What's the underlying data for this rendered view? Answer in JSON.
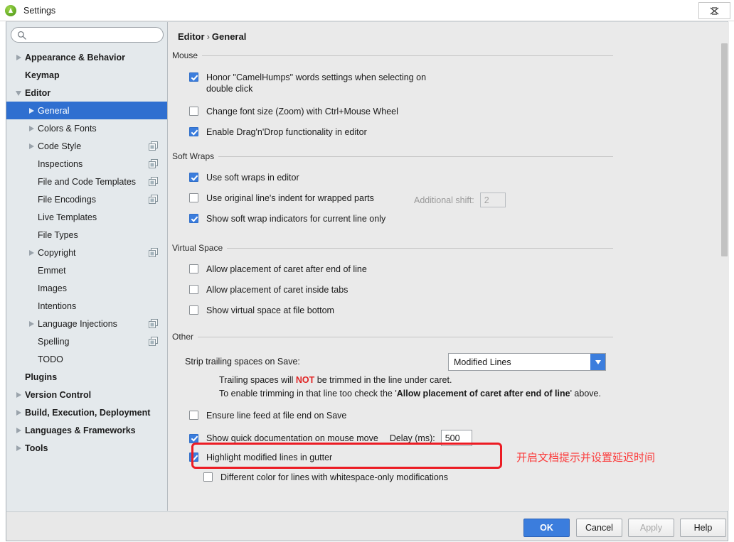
{
  "window": {
    "title": "Settings",
    "app_icon": "pycharm-icon",
    "close_label": "✕"
  },
  "sidebar": {
    "search": {
      "value": "",
      "placeholder": "",
      "icon": "search-icon"
    },
    "items": [
      {
        "label": "Appearance & Behavior",
        "indent": 0,
        "bold": true,
        "twisty": "right",
        "copy": false,
        "selected": false
      },
      {
        "label": "Keymap",
        "indent": 0,
        "bold": true,
        "twisty": "none",
        "copy": false,
        "selected": false
      },
      {
        "label": "Editor",
        "indent": 0,
        "bold": true,
        "twisty": "down",
        "copy": false,
        "selected": false
      },
      {
        "label": "General",
        "indent": 1,
        "bold": false,
        "twisty": "right",
        "copy": false,
        "selected": true
      },
      {
        "label": "Colors & Fonts",
        "indent": 1,
        "bold": false,
        "twisty": "right",
        "copy": false,
        "selected": false
      },
      {
        "label": "Code Style",
        "indent": 1,
        "bold": false,
        "twisty": "right",
        "copy": true,
        "selected": false
      },
      {
        "label": "Inspections",
        "indent": 1,
        "bold": false,
        "twisty": "none",
        "copy": true,
        "selected": false
      },
      {
        "label": "File and Code Templates",
        "indent": 1,
        "bold": false,
        "twisty": "none",
        "copy": true,
        "selected": false
      },
      {
        "label": "File Encodings",
        "indent": 1,
        "bold": false,
        "twisty": "none",
        "copy": true,
        "selected": false
      },
      {
        "label": "Live Templates",
        "indent": 1,
        "bold": false,
        "twisty": "none",
        "copy": false,
        "selected": false
      },
      {
        "label": "File Types",
        "indent": 1,
        "bold": false,
        "twisty": "none",
        "copy": false,
        "selected": false
      },
      {
        "label": "Copyright",
        "indent": 1,
        "bold": false,
        "twisty": "right",
        "copy": true,
        "selected": false
      },
      {
        "label": "Emmet",
        "indent": 1,
        "bold": false,
        "twisty": "none",
        "copy": false,
        "selected": false
      },
      {
        "label": "Images",
        "indent": 1,
        "bold": false,
        "twisty": "none",
        "copy": false,
        "selected": false
      },
      {
        "label": "Intentions",
        "indent": 1,
        "bold": false,
        "twisty": "none",
        "copy": false,
        "selected": false
      },
      {
        "label": "Language Injections",
        "indent": 1,
        "bold": false,
        "twisty": "right",
        "copy": true,
        "selected": false
      },
      {
        "label": "Spelling",
        "indent": 1,
        "bold": false,
        "twisty": "none",
        "copy": true,
        "selected": false
      },
      {
        "label": "TODO",
        "indent": 1,
        "bold": false,
        "twisty": "none",
        "copy": false,
        "selected": false
      },
      {
        "label": "Plugins",
        "indent": 0,
        "bold": true,
        "twisty": "none",
        "copy": false,
        "selected": false
      },
      {
        "label": "Version Control",
        "indent": 0,
        "bold": true,
        "twisty": "right",
        "copy": false,
        "selected": false
      },
      {
        "label": "Build, Execution, Deployment",
        "indent": 0,
        "bold": true,
        "twisty": "right",
        "copy": false,
        "selected": false
      },
      {
        "label": "Languages & Frameworks",
        "indent": 0,
        "bold": true,
        "twisty": "right",
        "copy": false,
        "selected": false
      },
      {
        "label": "Tools",
        "indent": 0,
        "bold": true,
        "twisty": "right",
        "copy": false,
        "selected": false
      }
    ]
  },
  "main": {
    "breadcrumb": {
      "root": "Editor",
      "separator": "›",
      "leaf": "General"
    },
    "sections": {
      "mouse": {
        "title": "Mouse",
        "options": [
          {
            "label": "Honor \"CamelHumps\" words settings when selecting on double click",
            "checked": true
          },
          {
            "label": "Change font size (Zoom) with Ctrl+Mouse Wheel",
            "checked": false
          },
          {
            "label": "Enable Drag'n'Drop functionality in editor",
            "checked": true
          }
        ]
      },
      "soft_wraps": {
        "title": "Soft Wraps",
        "options": [
          {
            "label": "Use soft wraps in editor",
            "checked": true
          },
          {
            "label": "Use original line's indent for wrapped parts",
            "checked": false
          },
          {
            "label": "Show soft wrap indicators for current line only",
            "checked": true
          }
        ],
        "additional_shift": {
          "label": "Additional shift:",
          "value": "2",
          "disabled": true
        }
      },
      "virtual_space": {
        "title": "Virtual Space",
        "options": [
          {
            "label": "Allow placement of caret after end of line",
            "checked": false
          },
          {
            "label": "Allow placement of caret inside tabs",
            "checked": false
          },
          {
            "label": "Show virtual space at file bottom",
            "checked": false
          }
        ]
      },
      "other": {
        "title": "Other",
        "strip_label": "Strip trailing spaces on Save:",
        "strip_value": "Modified Lines",
        "note_line1_pre": "Trailing spaces will ",
        "note_line1_em": "NOT",
        "note_line1_post": " be trimmed in the line under caret.",
        "note_line2_pre": "To enable trimming in that line too check the '",
        "note_line2_em": "Allow placement of caret after end of line",
        "note_line2_post": "' above.",
        "options": [
          {
            "label": "Ensure line feed at file end on Save",
            "checked": false
          },
          {
            "label": "Show quick documentation on mouse move",
            "checked": true
          },
          {
            "label": "Highlight modified lines in gutter",
            "checked": true
          },
          {
            "label": "Different color for lines with whitespace-only modifications",
            "checked": false
          }
        ],
        "delay": {
          "label": "Delay (ms):",
          "value": "500"
        }
      }
    },
    "annotation": {
      "text": "开启文档提示并设置延迟时间",
      "color": "#fb3b3b",
      "highlight_color": "#ec1c24"
    }
  },
  "footer": {
    "buttons": [
      {
        "label": "OK",
        "style": "primary"
      },
      {
        "label": "Cancel",
        "style": "normal"
      },
      {
        "label": "Apply",
        "style": "disabled"
      },
      {
        "label": "Help",
        "style": "normal"
      }
    ]
  },
  "colors": {
    "accent": "#3b7ddd",
    "selection": "#2f6fd0",
    "annotation_red": "#ec1c24",
    "warn_red": "#e02424"
  }
}
